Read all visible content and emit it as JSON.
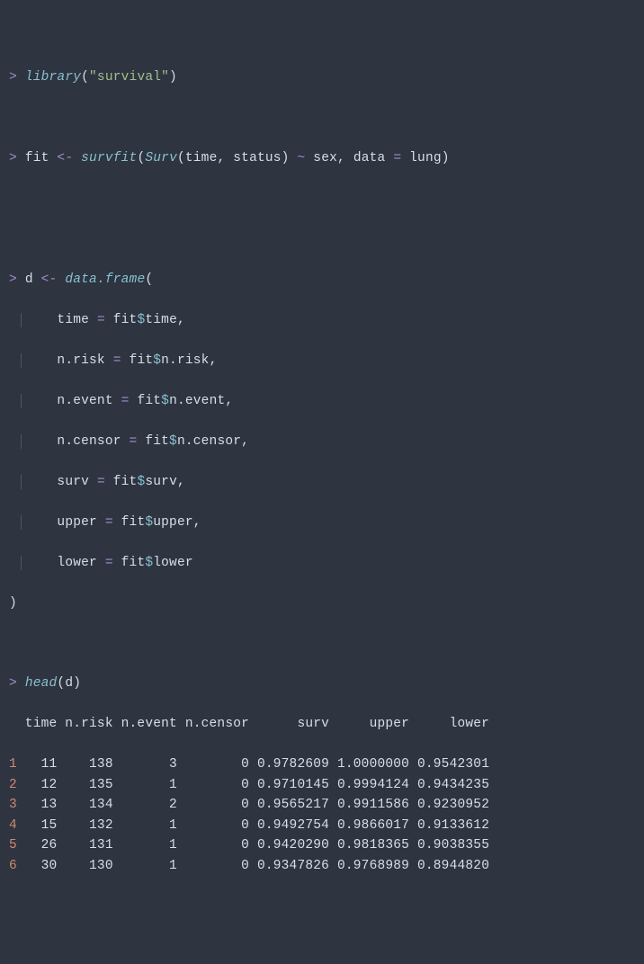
{
  "lines": {
    "l1_lib": "library",
    "l1_arg": "\"survival\"",
    "l2_fit": "fit ",
    "l2_survfit": "survfit",
    "l2_surv": "Surv",
    "l2_args": "(time, status) ",
    "l2_tilde": "~",
    "l2_rest": " sex, data ",
    "l2_eq": "=",
    "l2_lung": " lung)",
    "l3_d": "d ",
    "l3_df": "data.frame",
    "l4_time": "    time ",
    "l4_eq": "=",
    "l4_fit": " fit",
    "l4_dollar": "$",
    "l4_field": "time,",
    "l5_label": "    n.risk ",
    "l5_field": "n.risk,",
    "l6_label": "    n.event ",
    "l6_field": "n.event,",
    "l7_label": "    n.censor ",
    "l7_field": "n.censor,",
    "l8_label": "    surv ",
    "l8_field": "surv,",
    "l9_label": "    upper ",
    "l9_field": "upper,",
    "l10_label": "    lower ",
    "l10_field": "lower",
    "close_paren": ")",
    "head": "head",
    "head_arg": "(d)",
    "header": "  time n.risk n.event n.censor      surv     upper     lower",
    "rows": [
      {
        "n": "1",
        "line": "   11    138       3        0 0.9782609 1.0000000 0.9542301"
      },
      {
        "n": "2",
        "line": "   12    135       1        0 0.9710145 0.9994124 0.9434235"
      },
      {
        "n": "3",
        "line": "   13    134       2        0 0.9565217 0.9911586 0.9230952"
      },
      {
        "n": "4",
        "line": "   15    132       1        0 0.9492754 0.9866017 0.9133612"
      },
      {
        "n": "5",
        "line": "   26    131       1        0 0.9420290 0.9818365 0.9038355"
      },
      {
        "n": "6",
        "line": "   30    130       1        0 0.9347826 0.9768989 0.8944820"
      }
    ]
  },
  "chart_data": {
    "type": "table",
    "title": "head(d)",
    "columns": [
      "time",
      "n.risk",
      "n.event",
      "n.censor",
      "surv",
      "upper",
      "lower"
    ],
    "rows": [
      [
        11,
        138,
        3,
        0,
        0.9782609,
        1.0,
        0.9542301
      ],
      [
        12,
        135,
        1,
        0,
        0.9710145,
        0.9994124,
        0.9434235
      ],
      [
        13,
        134,
        2,
        0,
        0.9565217,
        0.9911586,
        0.9230952
      ],
      [
        15,
        132,
        1,
        0,
        0.9492754,
        0.9866017,
        0.9133612
      ],
      [
        26,
        131,
        1,
        0,
        0.942029,
        0.9818365,
        0.9038355
      ],
      [
        30,
        130,
        1,
        0,
        0.9347826,
        0.9768989,
        0.894482
      ]
    ]
  }
}
